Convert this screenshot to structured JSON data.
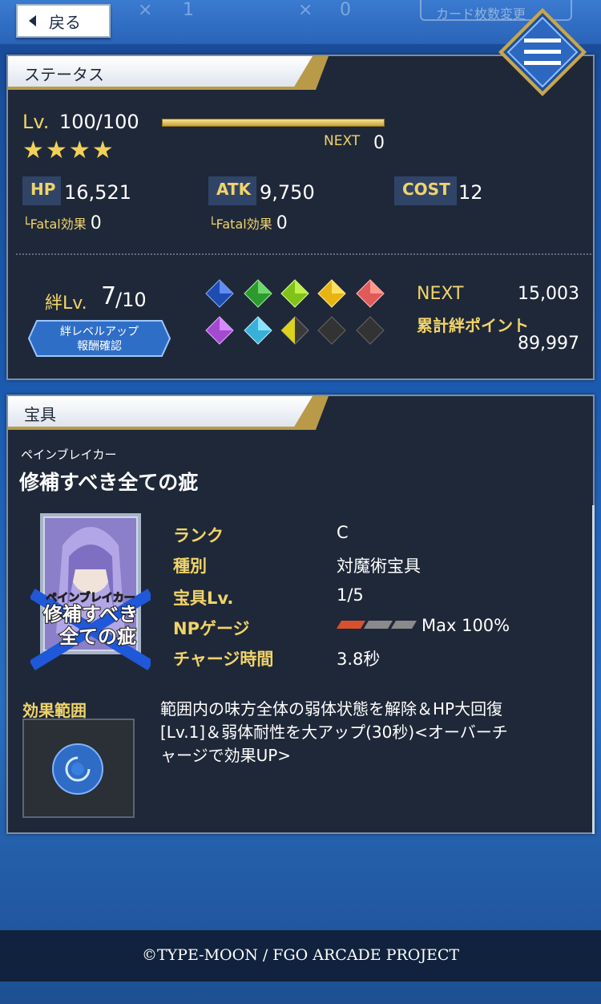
{
  "header": {
    "back_label": "戻る",
    "count_1": "1",
    "count_2": "0",
    "card_count_label": "カード枚数変更"
  },
  "status": {
    "title": "ステータス",
    "level_label": "Lv.",
    "level_value": "100/100",
    "next_label": "NEXT",
    "next_value": "0",
    "stars": 4,
    "hp_label": "HP",
    "hp_value": "16,521",
    "atk_label": "ATK",
    "atk_value": "9,750",
    "cost_label": "COST",
    "cost_value": "12",
    "fatal_label": "└Fatal効果",
    "fatal_hp": "0",
    "fatal_atk": "0",
    "bond_label": "絆Lv.",
    "bond_level": "7",
    "bond_max": "/10",
    "bond_button_line1": "絆レベルアップ",
    "bond_button_line2": "報酬確認",
    "bond_next_label": "NEXT",
    "bond_next_value": "15,003",
    "bond_total_label": "累計絆ポイント",
    "bond_total_value": "89,997"
  },
  "np": {
    "title": "宝具",
    "ruby": "ペインブレイカー",
    "name": "修補すべき全ての疵",
    "card_ruby": "ペインブレイカー",
    "card_line1": "修補すべき",
    "card_line2": "全ての疵",
    "rank_label": "ランク",
    "rank_value": "C",
    "type_label": "種別",
    "type_value": "対魔術宝具",
    "np_level_label": "宝具Lv.",
    "np_level_value": "1/5",
    "gauge_label": "NPゲージ",
    "gauge_value": "Max 100%",
    "charge_label": "チャージ時間",
    "charge_value": "3.8秒",
    "range_label": "効果範囲",
    "description_line1": "範囲内の味方全体の弱体状態を解除＆HP大回復",
    "description_line2": "[Lv.1]＆弱体耐性を大アップ(30秒)<オーバーチ",
    "description_line3": "ャージで効果UP>"
  },
  "footer": {
    "copyright": "©TYPE-MOON / FGO ARCADE PROJECT"
  }
}
